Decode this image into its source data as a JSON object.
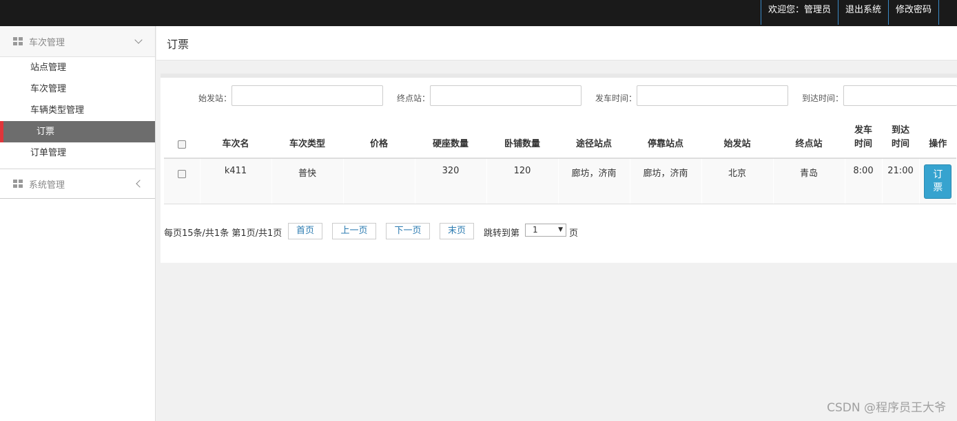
{
  "topnav": {
    "welcome": "欢迎您：管理员",
    "logout": "退出系统",
    "change_password": "修改密码"
  },
  "sidebar": {
    "groups": [
      {
        "label": "车次管理",
        "expanded": true,
        "items": [
          {
            "label": "站点管理"
          },
          {
            "label": "车次管理"
          },
          {
            "label": "车辆类型管理"
          },
          {
            "label": "订票",
            "active": true
          },
          {
            "label": "订单管理"
          }
        ]
      },
      {
        "label": "系统管理",
        "expanded": false
      }
    ]
  },
  "page": {
    "title": "订票"
  },
  "search": {
    "start_label": "始发站：",
    "end_label": "终点站：",
    "depart_label": "发车时间：",
    "arrive_label": "到达时间：",
    "start_value": "",
    "end_value": "",
    "depart_value": "",
    "arrive_value": ""
  },
  "table": {
    "headers": {
      "name": "车次名",
      "type": "车次类型",
      "price": "价格",
      "hard_seat": "硬座数量",
      "sleeper": "卧铺数量",
      "via": "途径站点",
      "stops": "停靠站点",
      "start": "始发站",
      "end": "终点站",
      "depart": "发车\n时间",
      "depart_l1": "发车",
      "depart_l2": "时间",
      "arrive_l1": "到达",
      "arrive_l2": "时间",
      "action": "操作"
    },
    "rows": [
      {
        "name": "k411",
        "type": "普快",
        "price": "",
        "hard_seat": "320",
        "sleeper": "120",
        "via": "廊坊，济南",
        "stops": "廊坊，济南",
        "start": "北京",
        "end": "青岛",
        "depart": "8:00",
        "arrive": "21:00",
        "action_l1": "订",
        "action_l2": "票"
      }
    ]
  },
  "pager": {
    "info": "每页15条/共1条 第1页/共1页",
    "first": "首页",
    "prev": "上一页",
    "next": "下一页",
    "last": "末页",
    "jump_label": "跳转到第",
    "page_value": "1",
    "page_suffix": "页"
  },
  "watermark": "CSDN @程序员王大爷",
  "colors": {
    "topbar": "#1a1a1a",
    "active_item": "#6d6d6d",
    "active_marker": "#e0363b",
    "book_button": "#36a3cf",
    "link": "#2a7ab0"
  }
}
